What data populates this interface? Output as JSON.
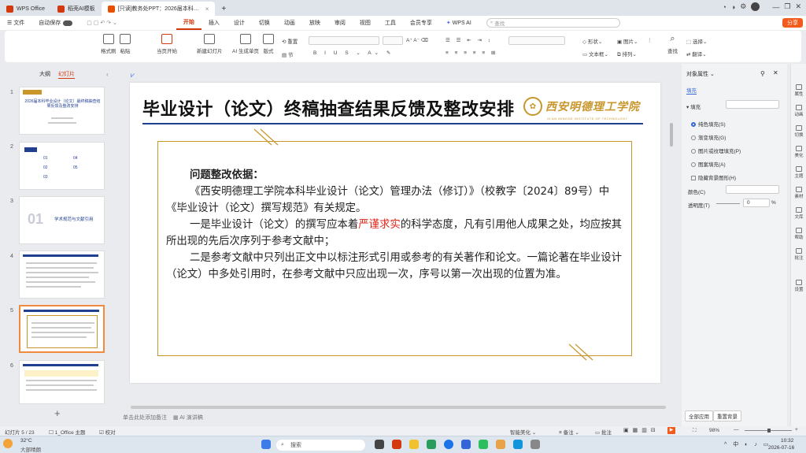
{
  "tabs": [
    {
      "label": "WPS Office",
      "color": "#d4380d"
    },
    {
      "label": "稻壳AI模板",
      "color": "#d4380d"
    },
    {
      "label": "[只读]教务处PPT：2026届本科…",
      "color": "#e65100"
    }
  ],
  "menu": {
    "file": "文件",
    "autosave": "自动保存",
    "items": [
      "开始",
      "插入",
      "设计",
      "切换",
      "动画",
      "放映",
      "审阅",
      "视图",
      "工具",
      "会员专享"
    ],
    "wpsai": "WPS AI",
    "search_placeholder": "查找",
    "share": "分享"
  },
  "ribbon": {
    "format_painter": "格式刷",
    "paste": "粘贴",
    "play_from_current": "当页开始",
    "new_slide": "新建幻灯片",
    "ai_generate": "AI 生成单页",
    "layout": "版式",
    "section": "节",
    "reset": "重置",
    "shape": "形状",
    "picture": "图片",
    "textbox": "文本框",
    "arrange": "排列",
    "find": "查找",
    "select": "选择",
    "translate": "翻译"
  },
  "left_panel": {
    "tabs": [
      "大纲",
      "幻灯片"
    ],
    "slides": [
      "1",
      "2",
      "3",
      "4",
      "5",
      "6"
    ],
    "slide1_title": "2026届本科毕业设计（论文）最终稿抽查结果反馈及整改安排",
    "slide3_title": "学术规范与文献引用",
    "slide3_num": "01"
  },
  "slide": {
    "title": "毕业设计（论文）终稿抽查结果反馈及整改安排",
    "logo_text": "西安明德理工学院",
    "logo_sub": "XI'AN MINGDE INSTITUTE OF TECHNOLOGY",
    "heading": "问题整改依据：",
    "para1": "《西安明德理工学院本科毕业设计（论文）管理办法（修订）》（校教字〔2024〕89号）中《毕业设计（论文）撰写规范》有关规定。",
    "para2_before": "一是毕业设计（论文）的撰写应本着",
    "para2_red": "严谨求实",
    "para2_after": "的科学态度，凡有引用他人成果之处，均应按其所出现的先后次序列于参考文献中；",
    "para3": "二是参考文献中只列出正文中以标注形式引用或参考的有关著作和论文。一篇论著在毕业设计（论文）中多处引用时，在参考文献中只应出现一次，序号以第一次出现的位置为准。"
  },
  "notes": {
    "placeholder": "单击此处添加备注",
    "ai_notes": "AI 演讲稿"
  },
  "right_panel": {
    "title": "对象属性",
    "tab": "填充",
    "section": "填充",
    "options": [
      "纯色填充(S)",
      "渐变填充(G)",
      "图片或纹理填充(P)",
      "图案填充(A)"
    ],
    "hide_bg": "隐藏背景图形(H)",
    "color_label": "颜色(C)",
    "transparency_label": "透明度(T)",
    "transparency_value": "0",
    "percent": "%",
    "apply_all": "全部应用",
    "reset_bg": "重置背景"
  },
  "sidebar": [
    "属性",
    "动画",
    "切换",
    "美化",
    "主题",
    "素材",
    "文库",
    "帮助",
    "批注",
    "设置"
  ],
  "status": {
    "slide_pos": "幻灯片 5 / 23",
    "theme": "1_Office 主题",
    "proof": "校对",
    "smart": "智能美化",
    "notes": "备注",
    "comments": "批注",
    "zoom": "98%"
  },
  "taskbar": {
    "temp": "32°C",
    "weather": "大部晴朗",
    "search": "搜索",
    "time": "10:32",
    "date": "2026-07-16"
  }
}
